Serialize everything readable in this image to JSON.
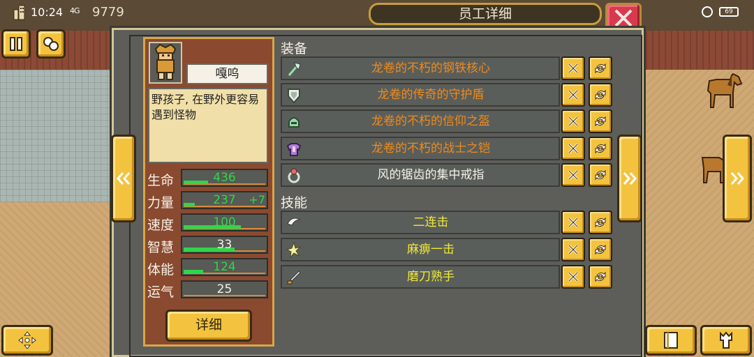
{
  "status": {
    "time": "10:24",
    "signal": "4G",
    "money": "9779",
    "battery": "69"
  },
  "title": "员工详细",
  "character": {
    "name": "嘎呜",
    "description": "野孩子, 在野外更容易遇到怪物",
    "stats": [
      {
        "label": "生命",
        "value": "436",
        "bonus": "",
        "color": "#2fd64a",
        "fill": 0.3
      },
      {
        "label": "力量",
        "value": "237",
        "bonus": "+7",
        "color": "#2fd64a",
        "fill": 0.14
      },
      {
        "label": "速度",
        "value": "100",
        "bonus": "",
        "color": "#2fd64a",
        "fill": 0.7
      },
      {
        "label": "智慧",
        "value": "33",
        "bonus": "",
        "color": "#f5f1e6",
        "fill": 0.62
      },
      {
        "label": "体能",
        "value": "124",
        "bonus": "",
        "color": "#2fd64a",
        "fill": 0.24
      },
      {
        "label": "运气",
        "value": "25",
        "bonus": "",
        "color": "#f5f1e6",
        "fill": 0.0
      }
    ],
    "detail_label": "详细"
  },
  "equipment": {
    "title": "装备",
    "items": [
      {
        "label": "龙卷的不朽的钢铁核心",
        "color": "#f08a1c",
        "icon": "axe-icon"
      },
      {
        "label": "龙卷的传奇的守护盾",
        "color": "#f08a1c",
        "icon": "shield-icon"
      },
      {
        "label": "龙卷的不朽的信仰之盔",
        "color": "#f08a1c",
        "icon": "helmet-icon"
      },
      {
        "label": "龙卷的不朽的战士之铠",
        "color": "#f08a1c",
        "icon": "armor-icon"
      },
      {
        "label": "风的锯齿的集中戒指",
        "color": "#f5f1e6",
        "icon": "ring-icon"
      }
    ]
  },
  "skills": {
    "title": "技能",
    "items": [
      {
        "label": "二连击",
        "color": "#f0ea34",
        "icon": "double-strike-icon"
      },
      {
        "label": "麻痹一击",
        "color": "#f0ea34",
        "icon": "paralyze-icon"
      },
      {
        "label": "磨刀熟手",
        "color": "#f0ea34",
        "icon": "sharpen-icon"
      }
    ]
  }
}
